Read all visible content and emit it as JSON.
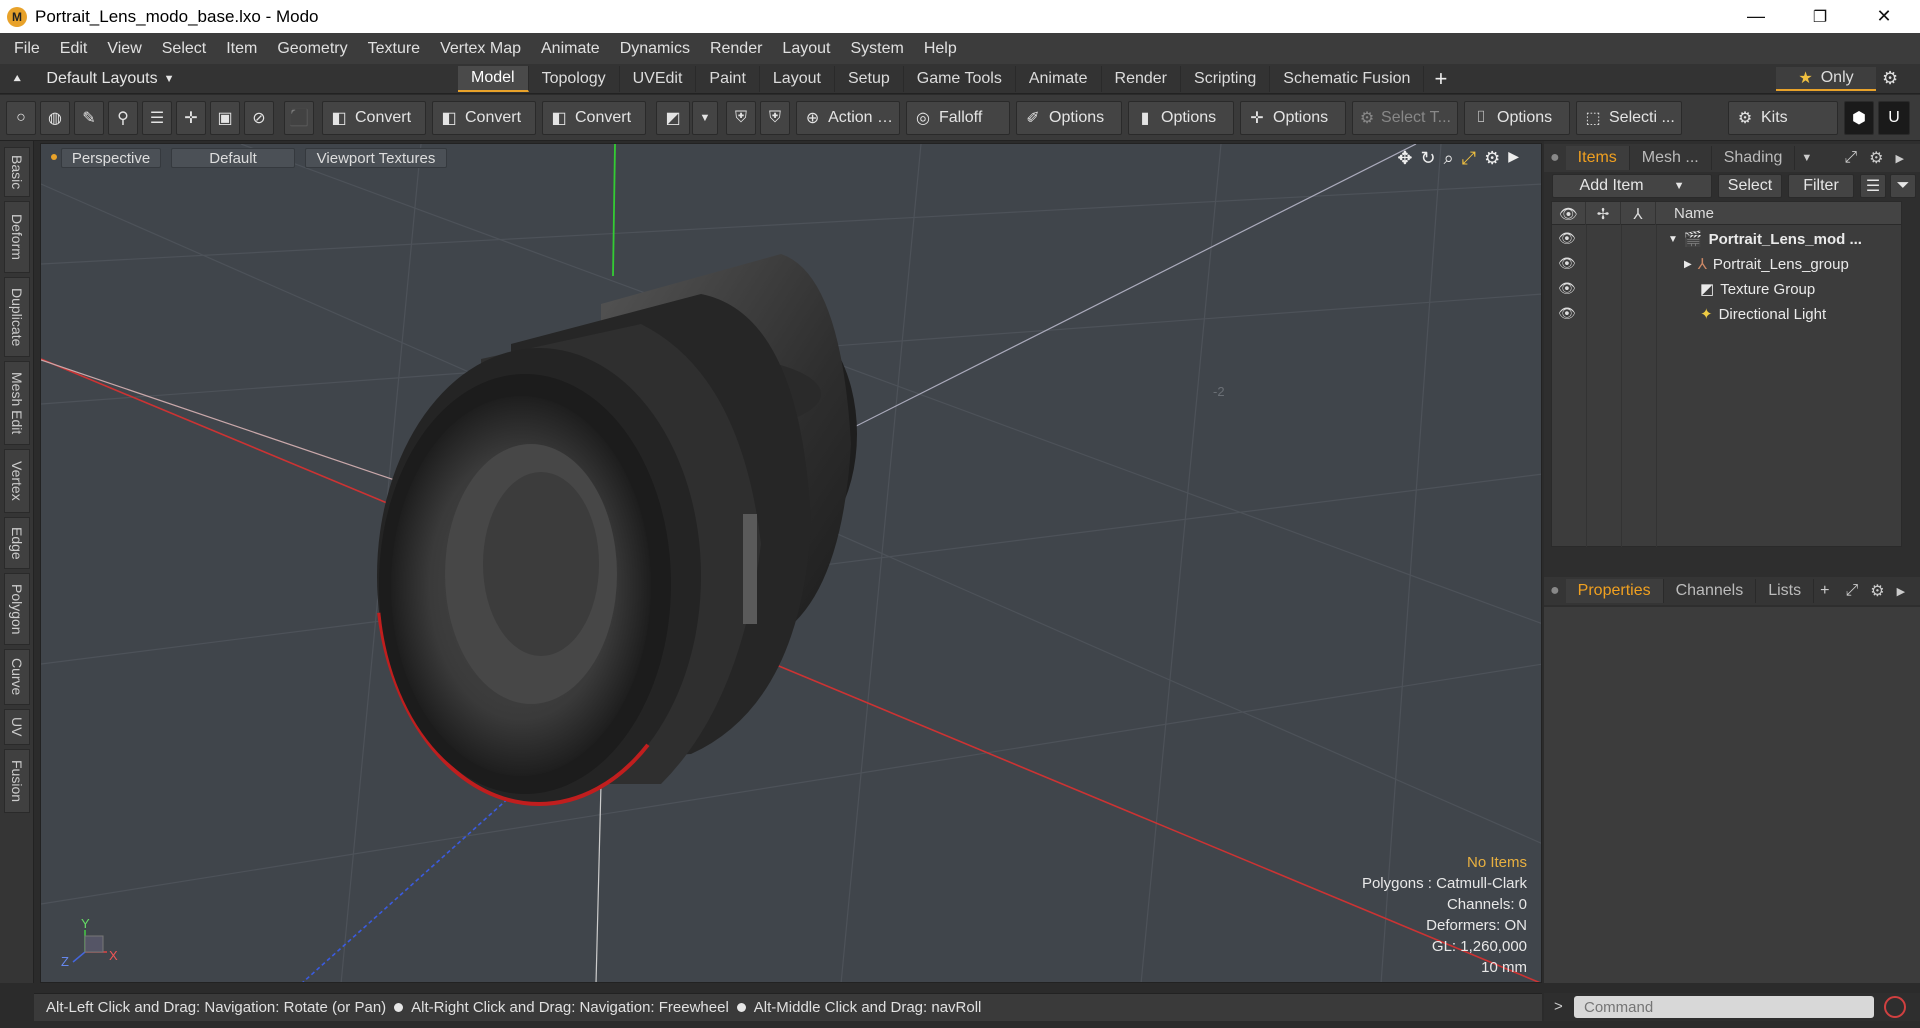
{
  "window": {
    "title": "Portrait_Lens_modo_base.lxo - Modo",
    "app_icon": "modo-logo-icon",
    "controls": {
      "minimize": "—",
      "maximize": "❐",
      "close": "✕"
    }
  },
  "menu": [
    "File",
    "Edit",
    "View",
    "Select",
    "Item",
    "Geometry",
    "Texture",
    "Vertex Map",
    "Animate",
    "Dynamics",
    "Render",
    "Layout",
    "System",
    "Help"
  ],
  "layout_bar": {
    "layout_select": "Default Layouts",
    "tabs": [
      "Model",
      "Topology",
      "UVEdit",
      "Paint",
      "Layout",
      "Setup",
      "Game Tools",
      "Animate",
      "Render",
      "Scripting",
      "Schematic Fusion"
    ],
    "active_tab": "Model",
    "only_label": "Only",
    "accent_color": "#e8a22a"
  },
  "toolbar": {
    "convert_1": "Convert",
    "convert_2": "Convert",
    "convert_3": "Convert",
    "action": "Action …",
    "falloff": "Falloff",
    "options_1": "Options",
    "options_2": "Options",
    "options_3": "Options",
    "select_t": "Select T...",
    "options_4": "Options",
    "selecti": "Selecti ...",
    "kits": "Kits"
  },
  "left_tabs": [
    "Basic",
    "Deform",
    "Duplicate",
    "Mesh Edit",
    "Vertex",
    "Edge",
    "Polygon",
    "Curve",
    "UV",
    "Fusion"
  ],
  "viewport": {
    "view_mode": "Perspective",
    "shading": "Default",
    "textures": "Viewport Textures",
    "grid_label": "-2",
    "axis_labels": {
      "y": "Y",
      "x": "X",
      "z": "Z"
    },
    "stats": {
      "selection": "No Items",
      "polygons": "Polygons : Catmull-Clark",
      "channels": "Channels: 0",
      "deformers": "Deformers: ON",
      "gl": "GL: 1,260,000",
      "grid": "10 mm"
    }
  },
  "status_bar": {
    "hint_1": "Alt-Left Click and Drag: Navigation: Rotate (or Pan)",
    "hint_2": "Alt-Right Click and Drag: Navigation: Freewheel",
    "hint_3": "Alt-Middle Click and Drag: navRoll"
  },
  "items_panel": {
    "tabs": [
      "Items",
      "Mesh ...",
      "Shading"
    ],
    "active_tab": "Items",
    "add_item": "Add Item",
    "select": "Select",
    "filter": "Filter",
    "column_name": "Name",
    "rows": [
      {
        "label": "Portrait_Lens_mod ...",
        "icon": "scene-icon",
        "bold": true
      },
      {
        "label": "Portrait_Lens_group",
        "icon": "group-locator-icon",
        "bold": false
      },
      {
        "label": "Texture Group",
        "icon": "texture-group-icon",
        "bold": false
      },
      {
        "label": "Directional Light",
        "icon": "directional-light-icon",
        "bold": false
      }
    ]
  },
  "properties_panel": {
    "tabs": [
      "Properties",
      "Channels",
      "Lists"
    ],
    "active_tab": "Properties"
  },
  "command": {
    "placeholder": "Command"
  }
}
